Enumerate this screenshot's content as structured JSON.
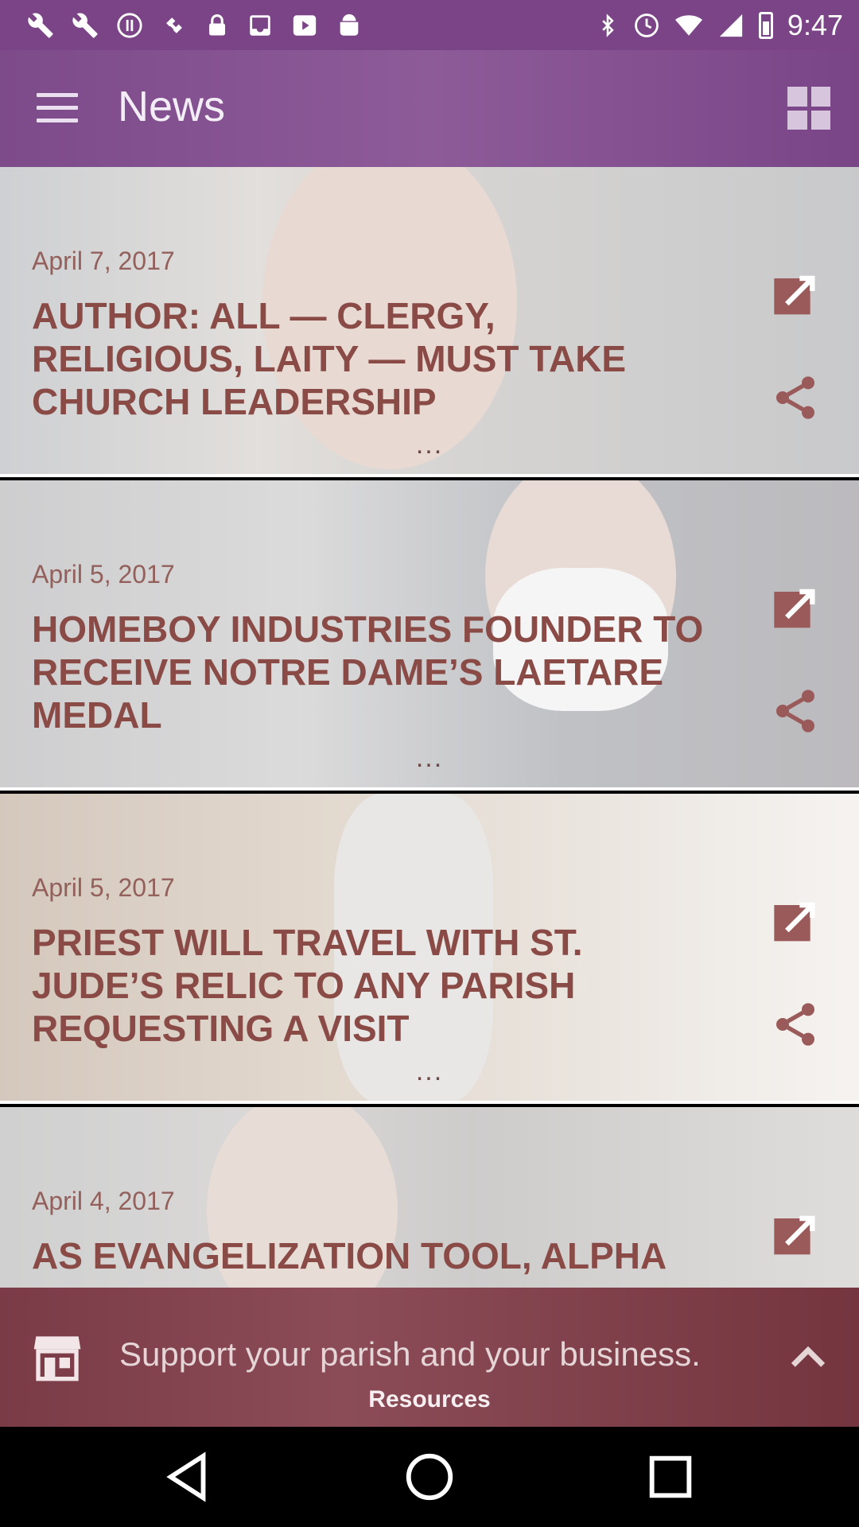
{
  "status_bar": {
    "time": "9:47",
    "left_icons": [
      "wrench-icon",
      "wrench-icon",
      "alert-icon",
      "fake-gps-icon",
      "lock-icon",
      "inbox-icon",
      "play-icon",
      "android-icon"
    ],
    "right_icons": [
      "bluetooth-icon",
      "clock-icon",
      "wifi-icon",
      "cell-signal-icon",
      "battery-icon"
    ]
  },
  "header": {
    "title": "News",
    "menu_icon": "hamburger-menu-icon",
    "layout_icon": "grid-view-icon",
    "color": "#7d4a8a"
  },
  "articles": [
    {
      "date": "April 7, 2017",
      "title": "AUTHOR: ALL — CLERGY, RELIGIOUS, LAITY — MUST TAKE CHURCH LEADERSHIP",
      "more": "...",
      "edit_icon": "external-link-icon",
      "share_icon": "share-icon"
    },
    {
      "date": "April 5, 2017",
      "title": "HOMEBOY INDUSTRIES FOUNDER TO RECEIVE NOTRE DAME’S LAETARE MEDAL",
      "more": "...",
      "edit_icon": "external-link-icon",
      "share_icon": "share-icon"
    },
    {
      "date": "April 5, 2017",
      "title": "PRIEST WILL TRAVEL WITH ST. JUDE’S RELIC TO ANY PARISH REQUESTING A VISIT",
      "more": "...",
      "edit_icon": "external-link-icon",
      "share_icon": "share-icon"
    },
    {
      "date": "April 4, 2017",
      "title": "AS EVANGELIZATION TOOL, ALPHA",
      "more": "",
      "edit_icon": "external-link-icon",
      "share_icon": "share-icon"
    }
  ],
  "footer": {
    "banner_text": "Support your parish and your business.",
    "label": "Resources",
    "store_icon": "store-icon",
    "expand_icon": "chevron-up-icon",
    "color": "#7a3b47"
  },
  "nav_bar": {
    "back_icon": "back-triangle-icon",
    "home_icon": "home-circle-icon",
    "recents_icon": "recents-square-icon"
  },
  "colors": {
    "article_date": "#93605c",
    "article_title": "#8a4b47",
    "action_icon": "#9b5a5a"
  }
}
